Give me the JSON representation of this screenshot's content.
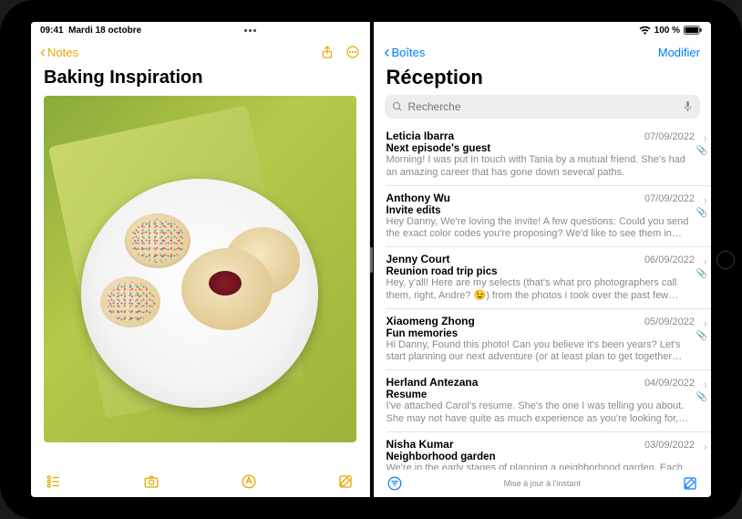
{
  "status": {
    "time": "09:41",
    "date": "Mardi 18 octobre",
    "battery": "100 %",
    "wifi": "wifi"
  },
  "notes": {
    "back_label": "Notes",
    "title": "Baking Inspiration",
    "toolbar": {
      "checklist": "checklist",
      "camera": "camera",
      "markup": "markup",
      "compose": "compose"
    }
  },
  "mail": {
    "back_label": "Boîtes",
    "edit_label": "Modifier",
    "title": "Réception",
    "search_placeholder": "Recherche",
    "status_text": "Mise à jour à l'instant",
    "items": [
      {
        "sender": "Leticia Ibarra",
        "date": "07/09/2022",
        "subject": "Next episode's guest",
        "preview": "Morning! I was put in touch with Tania by a mutual friend. She's had an amazing career that has gone down several paths.",
        "attachment": true
      },
      {
        "sender": "Anthony Wu",
        "date": "07/09/2022",
        "subject": "Invite edits",
        "preview": "Hey Danny, We're loving the invite! A few questions: Could you send the exact color codes you're proposing? We'd like to see them in per…",
        "attachment": true
      },
      {
        "sender": "Jenny Court",
        "date": "06/09/2022",
        "subject": "Reunion road trip pics",
        "preview": "Hey, y'all! Here are my selects (that's what pro photographers call them, right, Andre? 😉) from the photos I took over the past few day…",
        "attachment": true
      },
      {
        "sender": "Xiaomeng Zhong",
        "date": "05/09/2022",
        "subject": "Fun memories",
        "preview": "Hi Danny, Found this photo! Can you believe it's been years? Let's start planning our next adventure (or at least plan to get together soon!) P…",
        "attachment": true
      },
      {
        "sender": "Herland Antezana",
        "date": "04/09/2022",
        "subject": "Resume",
        "preview": "I've attached Carol's resume. She's the one I was telling you about. She may not have quite as much experience as you're looking for, bu…",
        "attachment": true
      },
      {
        "sender": "Nisha Kumar",
        "date": "03/09/2022",
        "subject": "Neighborhood garden",
        "preview": "We're in the early stages of planning a neighborhood garden. Each family would be in charge of a plot. Bring your own watering can :) Le…",
        "attachment": false
      }
    ]
  }
}
